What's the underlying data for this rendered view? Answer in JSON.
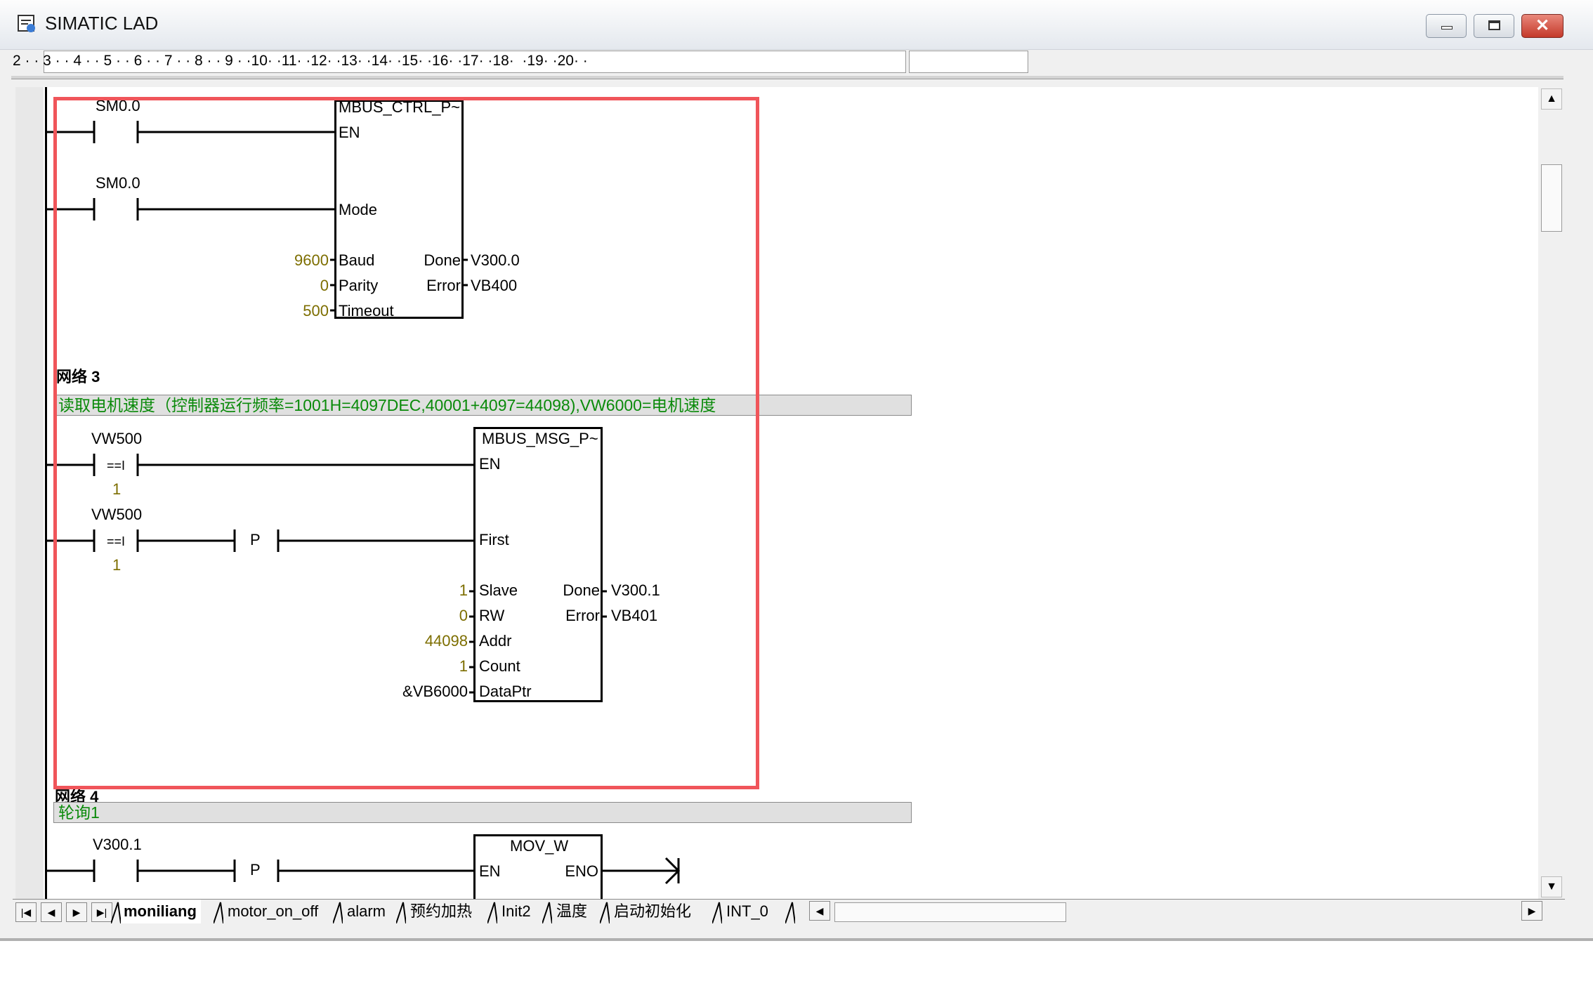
{
  "window": {
    "title": "SIMATIC LAD"
  },
  "ruler": {
    "text": "2 · · 3 · · 4 · · 5 · · 6 · · 7 · · 8 · · 9 · ·10· ·11· ·12· ·13· ·14· ·15· ·16· ·17· ·18·  ·19· ·20· ·"
  },
  "network2": {
    "contact1": "SM0.0",
    "contact2": "SM0.0",
    "block": {
      "name": "MBUS_CTRL_P~",
      "pins": {
        "en": "EN",
        "mode": "Mode",
        "baud": "Baud",
        "parity": "Parity",
        "timeout": "Timeout",
        "done": "Done",
        "error": "Error"
      },
      "inputs": {
        "baud": "9600",
        "parity": "0",
        "timeout": "500"
      },
      "outputs": {
        "done": "V300.0",
        "error": "VB400"
      }
    }
  },
  "network3": {
    "title": "网络 3",
    "comment": "读取电机速度（控制器运行频率=1001H=4097DEC,40001+4097=44098),VW6000=电机速度",
    "contact1": {
      "var": "VW500",
      "op": "==I",
      "val": "1"
    },
    "contact2": {
      "var": "VW500",
      "op": "==I",
      "val": "1"
    },
    "pedge": "P",
    "block": {
      "name": "MBUS_MSG_P~",
      "pins": {
        "en": "EN",
        "first": "First",
        "slave": "Slave",
        "rw": "RW",
        "addr": "Addr",
        "count": "Count",
        "dataptr": "DataPtr",
        "done": "Done",
        "error": "Error"
      },
      "inputs": {
        "slave": "1",
        "rw": "0",
        "addr": "44098",
        "count": "1",
        "dataptr": "&VB6000"
      },
      "outputs": {
        "done": "V300.1",
        "error": "VB401"
      }
    }
  },
  "network4": {
    "title": "网络 4",
    "comment": "轮询1",
    "contact1": "V300.1",
    "pedge": "P",
    "block": {
      "name": "MOV_W",
      "en": "EN",
      "eno": "ENO"
    }
  },
  "tabs": [
    "moniliang",
    "motor_on_off",
    "alarm",
    "预约加热",
    "Init2",
    "温度",
    "启动初始化",
    "INT_0"
  ],
  "colors": {
    "highlight": "#f0555a",
    "comment_text": "#0a8a0a",
    "constant": "#7d6e00"
  }
}
